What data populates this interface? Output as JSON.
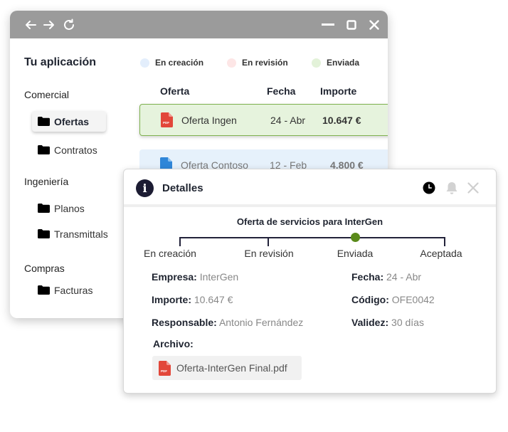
{
  "window": {
    "back_icon": "arrow-left-icon",
    "forward_icon": "arrow-right-icon",
    "reload_icon": "reload-icon",
    "minimize_icon": "minimize-icon",
    "maximize_icon": "maximize-icon",
    "close_icon": "close-icon"
  },
  "app_title": "Tu aplicación",
  "sidebar": {
    "sections": [
      {
        "label": "Comercial",
        "items": [
          {
            "label": "Ofertas",
            "active": true
          },
          {
            "label": "Contratos"
          }
        ]
      },
      {
        "label": "Ingeniería",
        "items": [
          {
            "label": "Planos"
          },
          {
            "label": "Transmittals"
          }
        ]
      },
      {
        "label": "Compras",
        "items": [
          {
            "label": "Facturas"
          }
        ]
      }
    ]
  },
  "legend": [
    {
      "label": "En creación",
      "color": "#e3eefc"
    },
    {
      "label": "En revisión",
      "color": "#fde6e6"
    },
    {
      "label": "Enviada",
      "color": "#e3f2d9"
    }
  ],
  "table": {
    "headers": [
      "Oferta",
      "Fecha",
      "Importe"
    ],
    "rows": [
      {
        "name": "Oferta Ingen",
        "date": "24 - Abr",
        "amount": "10.647 €",
        "status": "Enviada"
      },
      {
        "name": "Oferta Contoso",
        "date": "12 - Feb",
        "amount": "4.800 €",
        "status": "En creación"
      }
    ]
  },
  "details": {
    "title": "Detalles",
    "offer_title": "Oferta de servicios para  InterGen",
    "timeline": [
      "En creación",
      "En revisión",
      "Enviada",
      "Aceptada"
    ],
    "timeline_current": 2,
    "fields": {
      "empresa_label": "Empresa:",
      "empresa": "InterGen",
      "importe_label": "Importe:",
      "importe": "10.647 €",
      "responsable_label": "Responsable:",
      "responsable": "Antonio Fernández",
      "fecha_label": "Fecha:",
      "fecha": "24 - Abr",
      "codigo_label": "Código:",
      "codigo": "OFE0042",
      "validez_label": "Validez:",
      "validez": "30 días"
    },
    "archivo_label": "Archivo:",
    "file_name": "Oferta-InterGen Final.pdf",
    "pdf_badge": "PDF"
  },
  "colors": {
    "selected_row": "#e6f3dd",
    "selected_border": "#7fb24f",
    "timeline_active": "#5a8a1a",
    "pdf_red": "#e2473a",
    "doc_blue": "#2f86d8"
  }
}
